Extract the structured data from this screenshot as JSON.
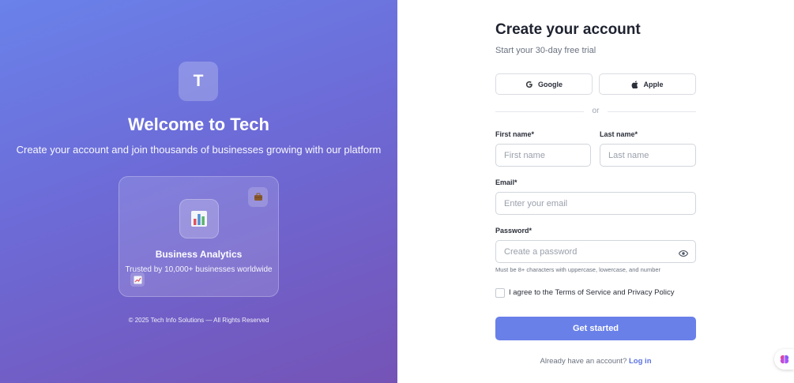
{
  "hero": {
    "logo_letter": "T",
    "title": "Welcome to Tech",
    "subtitle": "Create your account and join thousands of businesses growing with our platform",
    "card": {
      "title": "Business Analytics",
      "text": "Trusted by 10,000+ businesses worldwide",
      "top_badge_icon": "briefcase-icon",
      "center_icon": "bar-chart-icon",
      "bottom_badge_icon": "trend-chart-icon"
    },
    "footer": "© 2025 Tech Info Solutions — All Rights Reserved",
    "gradient_colors": [
      "#6a82ea",
      "#7553b6"
    ]
  },
  "form": {
    "title": "Create your account",
    "subtitle": "Start your 30-day free trial",
    "social": {
      "google_label": "Google",
      "apple_label": "Apple"
    },
    "divider": "or",
    "first_name": {
      "label": "First name*",
      "placeholder": "First name",
      "value": ""
    },
    "last_name": {
      "label": "Last name*",
      "placeholder": "Last name",
      "value": ""
    },
    "email": {
      "label": "Email*",
      "placeholder": "Enter your email",
      "value": ""
    },
    "password": {
      "label": "Password*",
      "placeholder": "Create a password",
      "value": "",
      "hint": "Must be 8+ characters with uppercase, lowercase, and number"
    },
    "agree": {
      "checked": false,
      "label": "I agree to the Terms of Service and Privacy Policy"
    },
    "submit_label": "Get started",
    "login_prompt": "Already have an account?",
    "login_link": "Log in",
    "accent_color": "#6980e9"
  },
  "assistant_icon": "brain-icon"
}
